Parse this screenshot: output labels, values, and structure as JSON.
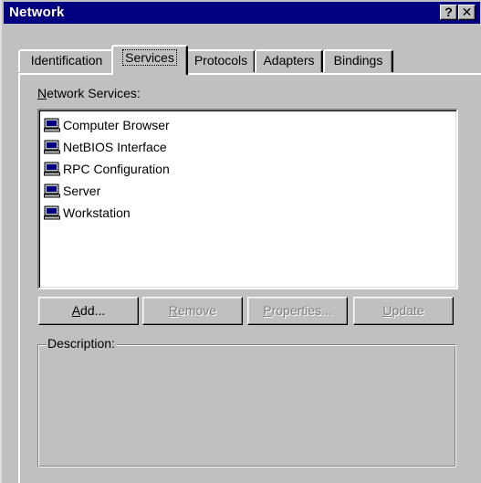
{
  "window": {
    "title": "Network",
    "help_glyph": "?",
    "close_glyph": "✕"
  },
  "tabs": [
    {
      "label": "Identification",
      "active": false
    },
    {
      "label": "Services",
      "active": true
    },
    {
      "label": "Protocols",
      "active": false
    },
    {
      "label": "Adapters",
      "active": false
    },
    {
      "label": "Bindings",
      "active": false
    }
  ],
  "services_panel": {
    "list_label_accel": "N",
    "list_label_rest": "etwork Services:",
    "items": [
      {
        "label": "Computer Browser",
        "icon": "computer-icon"
      },
      {
        "label": "NetBIOS Interface",
        "icon": "computer-icon"
      },
      {
        "label": "RPC Configuration",
        "icon": "computer-icon"
      },
      {
        "label": "Server",
        "icon": "computer-icon"
      },
      {
        "label": "Workstation",
        "icon": "computer-icon"
      }
    ],
    "buttons": {
      "add": {
        "accel": "A",
        "rest": "dd...",
        "enabled": true
      },
      "remove": {
        "accel": "R",
        "rest": "emove",
        "enabled": false
      },
      "properties": {
        "accel": "P",
        "rest": "roperties...",
        "enabled": false
      },
      "update": {
        "accel": "U",
        "rest": "pdate",
        "enabled": false
      }
    },
    "description_label": "Description:"
  },
  "colors": {
    "face": "#c0c0c0",
    "titlebar": "#000080",
    "disabled_text": "#808080"
  }
}
